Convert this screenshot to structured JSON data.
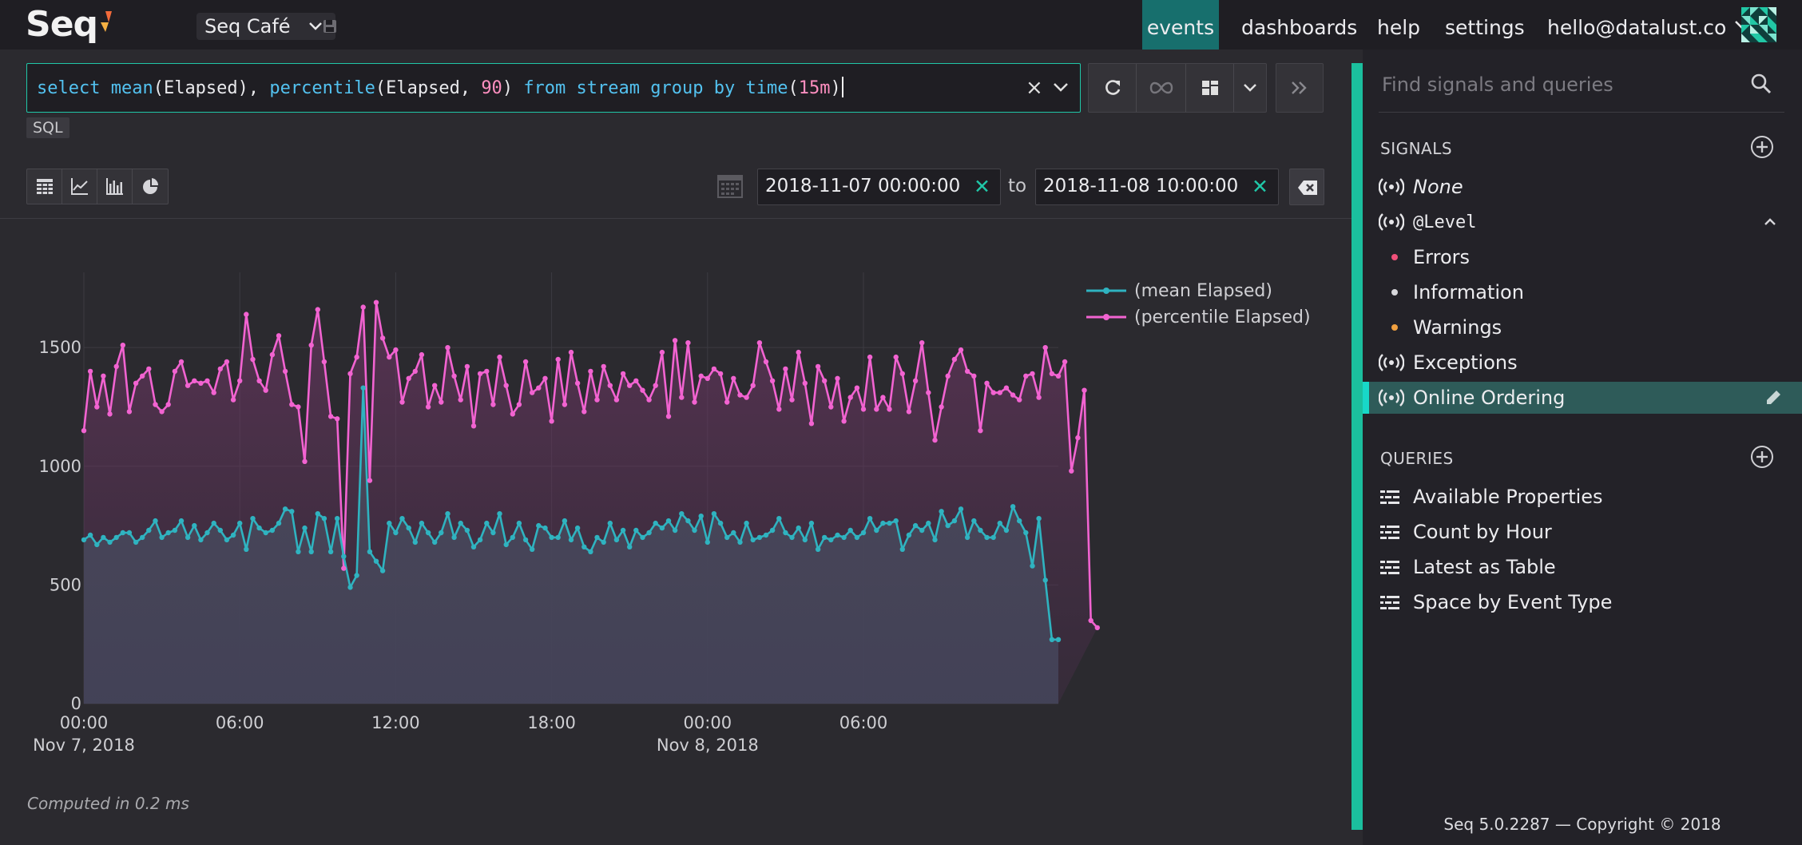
{
  "app": {
    "logo": "Seq",
    "workspace": "Seq Café"
  },
  "nav": [
    {
      "label": "events",
      "active": true
    },
    {
      "label": "dashboards",
      "active": false
    },
    {
      "label": "help",
      "active": false
    },
    {
      "label": "settings",
      "active": false
    }
  ],
  "user": {
    "email": "hello@datalust.co"
  },
  "query": {
    "tokens": [
      {
        "t": "select ",
        "k": "kw"
      },
      {
        "t": "mean",
        "k": "kw"
      },
      {
        "t": "(Elapsed), ",
        "k": "plain"
      },
      {
        "t": "percentile",
        "k": "kw"
      },
      {
        "t": "(Elapsed, ",
        "k": "plain"
      },
      {
        "t": "90",
        "k": "num"
      },
      {
        "t": ") ",
        "k": "plain"
      },
      {
        "t": "from stream group by time",
        "k": "kw"
      },
      {
        "t": "(",
        "k": "plain"
      },
      {
        "t": "15m",
        "k": "num"
      },
      {
        "t": ")",
        "k": "plain"
      }
    ],
    "mode": "SQL"
  },
  "time_range": {
    "from": "2018-11-07 00:00:00",
    "to_label": "to",
    "to": "2018-11-08 10:00:00"
  },
  "chart_data": {
    "type": "line",
    "x_start": "2018-11-07 00:00",
    "x_step_minutes": 15,
    "x_ticks": [
      "00:00",
      "06:00",
      "12:00",
      "18:00",
      "00:00",
      "06:00"
    ],
    "x_date_labels": [
      {
        "at_tick": 0,
        "label": "Nov 7, 2018"
      },
      {
        "at_tick": 4,
        "label": "Nov 8, 2018"
      }
    ],
    "y_ticks": [
      0,
      500,
      1000,
      1500
    ],
    "ylim": [
      0,
      1800
    ],
    "grid": true,
    "legend_position": "top-right",
    "series": [
      {
        "name": "(mean Elapsed)",
        "color": "#2fb3c0",
        "values": [
          690,
          710,
          670,
          700,
          680,
          700,
          720,
          720,
          680,
          700,
          730,
          770,
          700,
          720,
          730,
          770,
          700,
          750,
          690,
          720,
          760,
          730,
          690,
          710,
          760,
          650,
          780,
          740,
          720,
          730,
          760,
          820,
          810,
          640,
          740,
          640,
          800,
          780,
          640,
          780,
          620,
          490,
          540,
          1330,
          640,
          600,
          560,
          760,
          720,
          780,
          740,
          680,
          760,
          720,
          680,
          720,
          800,
          700,
          760,
          730,
          660,
          690,
          760,
          720,
          800,
          670,
          700,
          760,
          690,
          650,
          750,
          740,
          700,
          700,
          770,
          690,
          740,
          660,
          640,
          700,
          680,
          760,
          690,
          730,
          660,
          730,
          700,
          720,
          760,
          740,
          770,
          730,
          800,
          770,
          730,
          790,
          680,
          800,
          760,
          700,
          720,
          680,
          760,
          690,
          700,
          710,
          730,
          780,
          720,
          700,
          740,
          690,
          760,
          650,
          700,
          690,
          710,
          700,
          730,
          700,
          720,
          780,
          730,
          760,
          760,
          770,
          650,
          710,
          750,
          730,
          760,
          690,
          810,
          750,
          770,
          820,
          700,
          770,
          730,
          700,
          700,
          760,
          730,
          830,
          770,
          720,
          580,
          780,
          520,
          270,
          270
        ]
      },
      {
        "name": "(percentile Elapsed)",
        "color": "#f263d1",
        "values": [
          1150,
          1400,
          1250,
          1380,
          1220,
          1420,
          1510,
          1230,
          1350,
          1380,
          1410,
          1260,
          1230,
          1260,
          1400,
          1440,
          1340,
          1360,
          1350,
          1360,
          1310,
          1410,
          1440,
          1280,
          1360,
          1640,
          1450,
          1360,
          1320,
          1470,
          1550,
          1400,
          1260,
          1250,
          1020,
          1510,
          1660,
          1440,
          1210,
          1200,
          570,
          1390,
          1460,
          1670,
          940,
          1690,
          1540,
          1460,
          1490,
          1270,
          1370,
          1400,
          1470,
          1250,
          1340,
          1270,
          1500,
          1380,
          1280,
          1420,
          1170,
          1390,
          1400,
          1260,
          1460,
          1340,
          1220,
          1260,
          1440,
          1310,
          1330,
          1370,
          1190,
          1450,
          1260,
          1480,
          1350,
          1230,
          1400,
          1280,
          1420,
          1340,
          1280,
          1390,
          1340,
          1360,
          1320,
          1280,
          1340,
          1480,
          1210,
          1530,
          1290,
          1520,
          1270,
          1380,
          1370,
          1410,
          1390,
          1270,
          1370,
          1300,
          1290,
          1340,
          1520,
          1440,
          1360,
          1240,
          1410,
          1280,
          1480,
          1350,
          1180,
          1420,
          1360,
          1250,
          1370,
          1190,
          1290,
          1330,
          1240,
          1460,
          1240,
          1290,
          1240,
          1460,
          1390,
          1230,
          1360,
          1520,
          1310,
          1110,
          1250,
          1380,
          1450,
          1490,
          1400,
          1380,
          1150,
          1350,
          1310,
          1310,
          1330,
          1300,
          1280,
          1380,
          1390,
          1290,
          1500,
          1390,
          1380,
          1440,
          980,
          1120,
          1320,
          350,
          320
        ]
      }
    ]
  },
  "status": {
    "computed": "Computed in 0.2 ms"
  },
  "sidebar": {
    "search_placeholder": "Find signals and queries",
    "signals_title": "SIGNALS",
    "signals": [
      {
        "label": "None"
      },
      {
        "label": "@Level"
      },
      {
        "label": "Errors",
        "dot": "#f0507a"
      },
      {
        "label": "Information",
        "dot": "#d8d8dc"
      },
      {
        "label": "Warnings",
        "dot": "#f0a040"
      },
      {
        "label": "Exceptions"
      },
      {
        "label": "Online Ordering"
      }
    ],
    "queries_title": "QUERIES",
    "queries": [
      {
        "label": "Available Properties"
      },
      {
        "label": "Count by Hour"
      },
      {
        "label": "Latest as Table"
      },
      {
        "label": "Space by Event Type"
      }
    ],
    "footer": "Seq 5.0.2287 — Copyright © 2018"
  }
}
